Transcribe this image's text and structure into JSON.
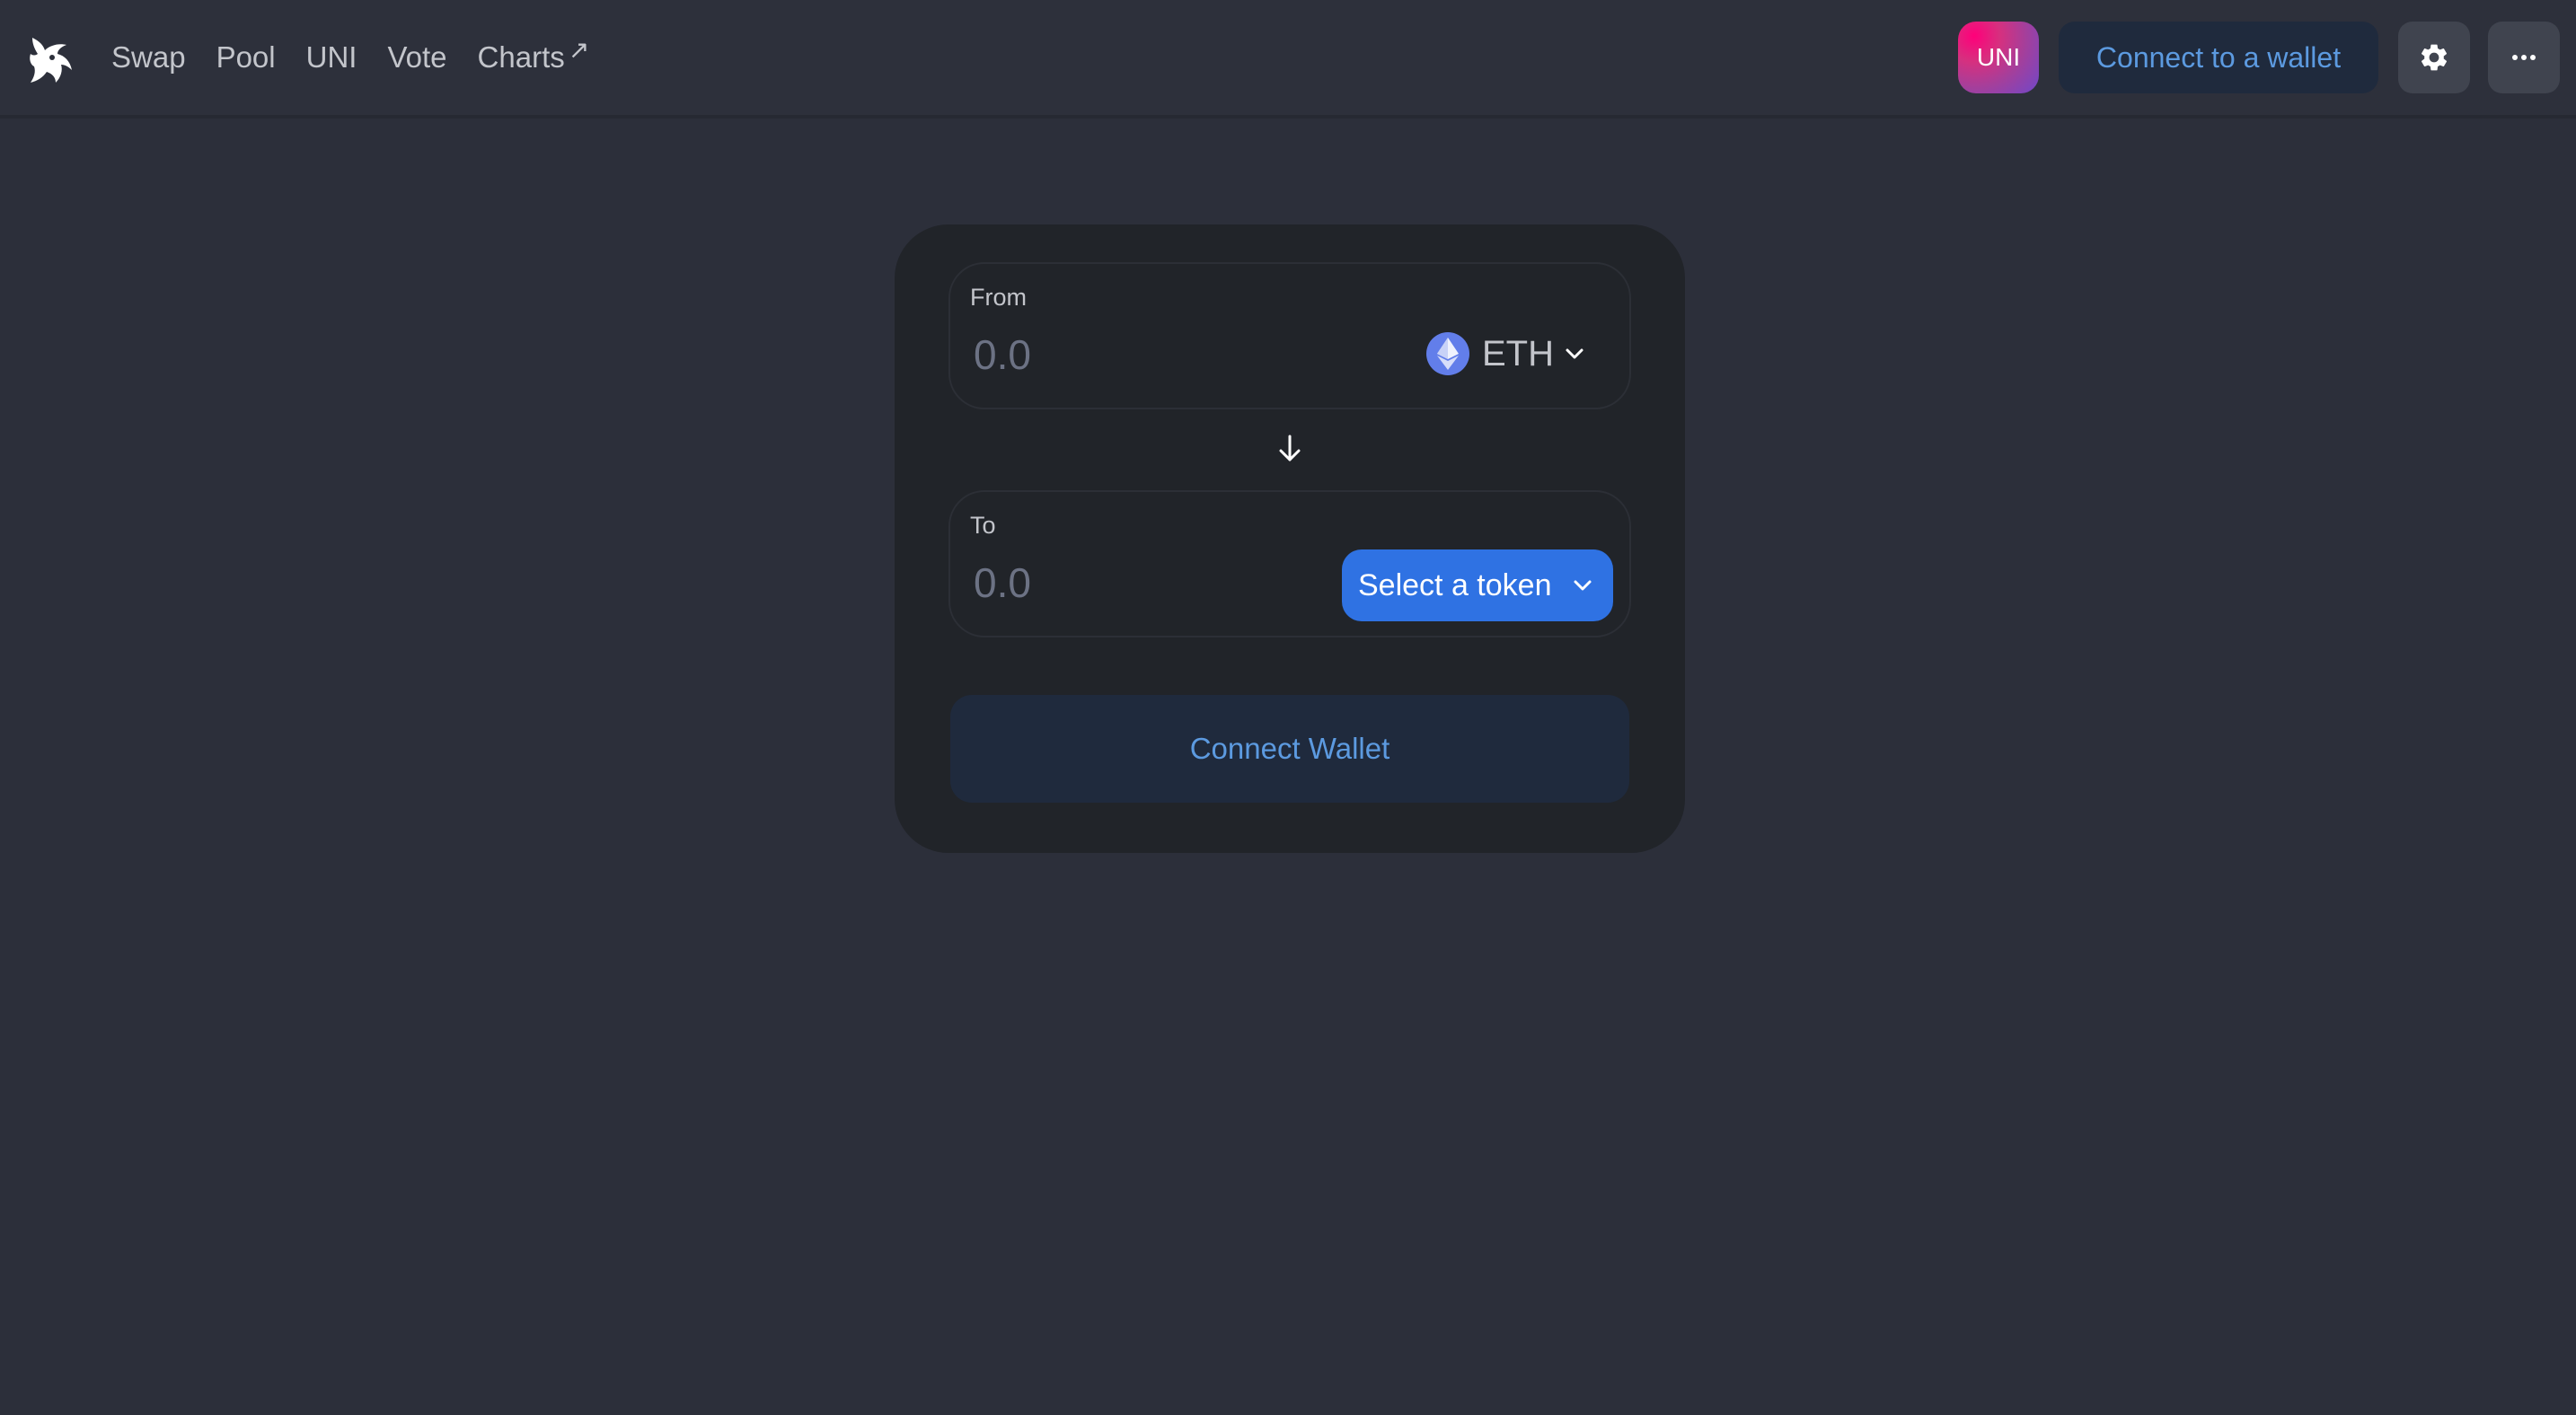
{
  "header": {
    "nav": [
      {
        "label": "Swap"
      },
      {
        "label": "Pool"
      },
      {
        "label": "UNI"
      },
      {
        "label": "Vote"
      },
      {
        "label": "Charts",
        "external_glyph": "↗"
      }
    ],
    "uni_badge": "UNI",
    "connect_label": "Connect to a wallet",
    "settings_icon": "gear-icon",
    "more_icon": "more-dots-icon"
  },
  "swap": {
    "from": {
      "label": "From",
      "amount_placeholder": "0.0",
      "token": "ETH"
    },
    "to": {
      "label": "To",
      "amount_placeholder": "0.0",
      "select_label": "Select a token"
    },
    "connect_wallet_label": "Connect Wallet"
  },
  "colors": {
    "background": "#2c2f3a",
    "card": "#212429",
    "accent_blue": "#2f72e3",
    "connect_text": "#5c9ae0",
    "uni_pink": "#ff007a"
  }
}
